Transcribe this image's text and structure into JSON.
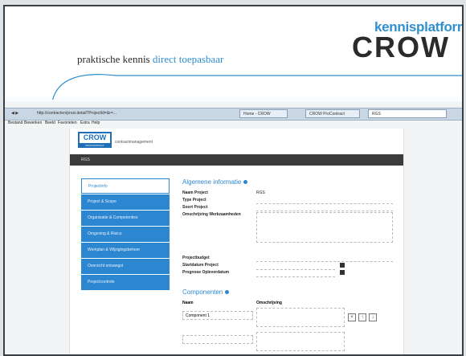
{
  "header": {
    "tagline_prefix": "praktische kennis ",
    "tagline_accent": "direct toepasbaar",
    "logo_top": "kennisplatform",
    "logo_main": "CROW"
  },
  "browser": {
    "address": "http://contracten/prosi.detail?ProjectId=&r=...",
    "tabs": [
      "Home - CROW",
      "CROW ProContract",
      "RGS"
    ],
    "menu": [
      "Bestand",
      "Bewerken",
      "Beeld",
      "Favorieten",
      "Extra",
      "Help"
    ]
  },
  "app": {
    "logo": "CROW",
    "logo_sub": "PROCONTRACT",
    "logo_text": "contractmanagement",
    "darkbar": "RGS",
    "sidebar": [
      "Projectinfo",
      "Project & Scope",
      "Organisatie & Competenties",
      "Omgeving & Risico",
      "Werkplan & Wijzigingsbeheer",
      "Overzicht ontvangst",
      "Projectcontrole"
    ],
    "general": {
      "title": "Algemene informatie",
      "name_label": "Naam Project",
      "name_value": "RGS",
      "type_label": "Type Project",
      "sort_label": "Soort Project",
      "desc_label": "Omschrijving Werkzaamheden",
      "budget_label": "Projectbudget",
      "start_label": "Startdatum Project",
      "end_label": "Prognose Opleverdatum"
    },
    "components": {
      "title": "Componenten",
      "col_name": "Naam",
      "col_desc": "Omschrijving",
      "row1": "Component 1"
    }
  }
}
